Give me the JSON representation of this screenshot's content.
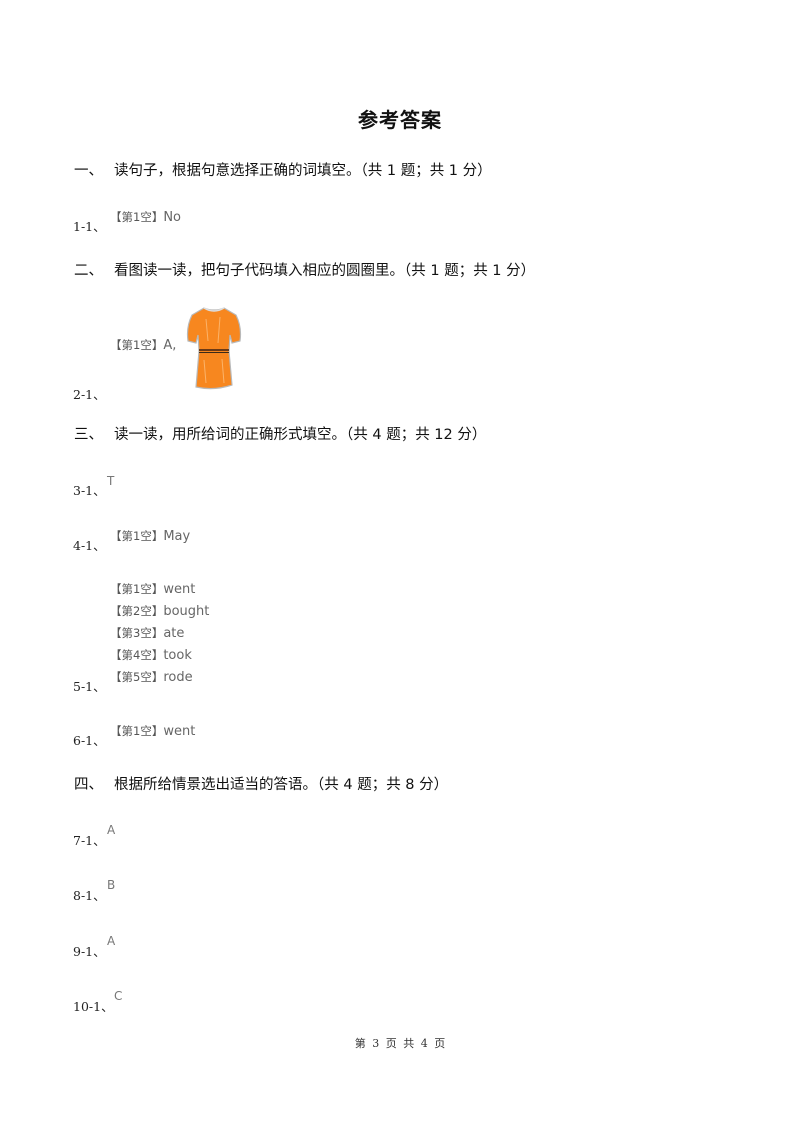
{
  "title": "参考答案",
  "sections": [
    {
      "num": "一、",
      "text": "读句子，根据句意选择正确的词填空。（共 1 题；共 1 分）"
    },
    {
      "num": "二、",
      "text": "看图读一读，把句子代码填入相应的圆圈里。（共 1 题；共 1 分）"
    },
    {
      "num": "三、",
      "text": "读一读，用所给词的正确形式填空。（共 4 题；共 12 分）"
    },
    {
      "num": "四、",
      "text": "根据所给情景选出适当的答语。（共 4 题；共 8 分）"
    }
  ],
  "questions": {
    "q1": {
      "num": "1-1、",
      "tag": "【第1空】",
      "answer": "No"
    },
    "q2": {
      "num": "2-1、",
      "tag": "【第1空】",
      "answer": "A,",
      "image": "orange-dress-picture"
    },
    "q3": {
      "num": "3-1、",
      "answer": "T"
    },
    "q4": {
      "num": "4-1、",
      "tag": "【第1空】",
      "answer": "May"
    },
    "q5": {
      "num": "5-1、",
      "blanks": [
        {
          "tag": "【第1空】",
          "answer": "went"
        },
        {
          "tag": "【第2空】",
          "answer": "bought"
        },
        {
          "tag": "【第3空】",
          "answer": "ate"
        },
        {
          "tag": "【第4空】",
          "answer": "took"
        },
        {
          "tag": "【第5空】",
          "answer": "rode"
        }
      ]
    },
    "q6": {
      "num": "6-1、",
      "tag": "【第1空】",
      "answer": "went"
    },
    "q7": {
      "num": "7-1、",
      "answer": "A"
    },
    "q8": {
      "num": "8-1、",
      "answer": "B"
    },
    "q9": {
      "num": "9-1、",
      "answer": "A"
    },
    "q10": {
      "num": "10-1、",
      "answer": "C"
    }
  },
  "footer": "第 3 页 共 4 页"
}
